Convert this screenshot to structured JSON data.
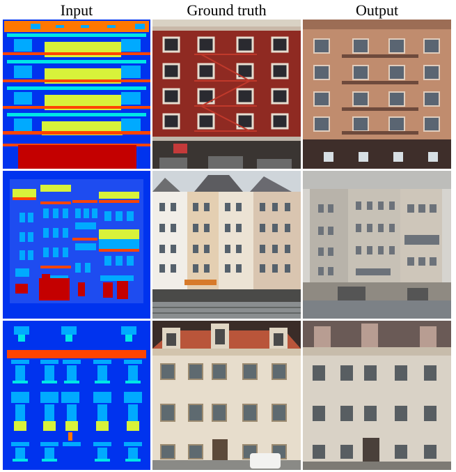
{
  "columns": [
    "Input",
    "Ground truth",
    "Output"
  ],
  "rows": [
    {
      "input": "label-map-1",
      "ground_truth": "facade-photo-1",
      "output": "facade-output-1"
    },
    {
      "input": "label-map-2",
      "ground_truth": "facade-photo-2",
      "output": "facade-output-2"
    },
    {
      "input": "label-map-3",
      "ground_truth": "facade-photo-3",
      "output": "facade-output-3"
    }
  ],
  "colors": {
    "background": "#0033ee",
    "wall": "#1e4cf0",
    "window": "#00aaff",
    "cyan_strip": "#00e6e6",
    "sill": "#ff4400",
    "yellow_panel": "#d8f23a",
    "shop": "#c40000",
    "orange_top": "#ff7700"
  }
}
